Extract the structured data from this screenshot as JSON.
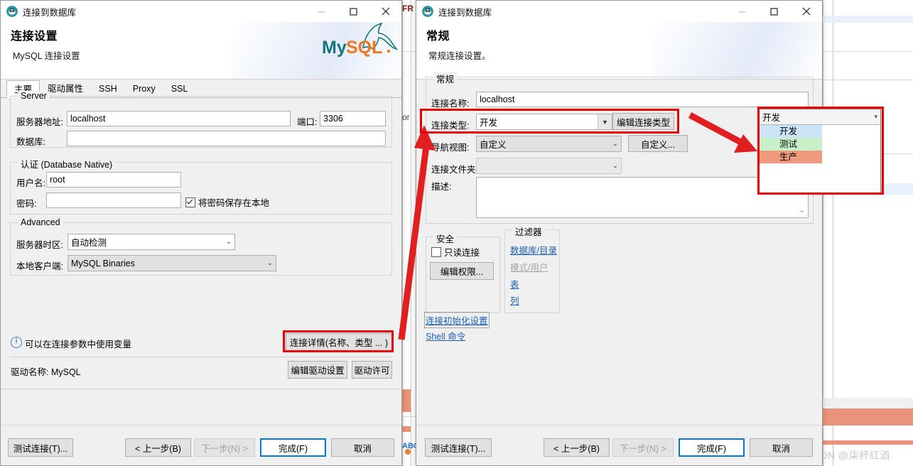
{
  "background": {
    "fragments": [
      {
        "text": "FR",
        "kind": "red"
      },
      {
        "text": "or",
        "kind": "plain"
      },
      {
        "text": "ABC",
        "kind": "blue"
      }
    ],
    "watermark": "CSDN @柒杯红酒"
  },
  "left_dialog": {
    "window_title": "连接到数据库",
    "icon": "app-icon",
    "min_label": "最小化",
    "max_label": "最大化",
    "close_label": "关闭",
    "header_title": "连接设置",
    "header_sub": "MySQL 连接设置",
    "brand": "MySQL",
    "tabs": [
      {
        "label": "主要",
        "active": true
      },
      {
        "label": "驱动属性",
        "active": false
      },
      {
        "label": "SSH",
        "active": false
      },
      {
        "label": "Proxy",
        "active": false
      },
      {
        "label": "SSL",
        "active": false
      }
    ],
    "server_group": {
      "legend": "Server",
      "host_label": "服务器地址:",
      "host_value": "localhost",
      "port_label": "端口:",
      "port_value": "3306",
      "db_label": "数据库:",
      "db_value": ""
    },
    "auth_group": {
      "legend": "认证 (Database Native)",
      "user_label": "用户名:",
      "user_value": "root",
      "pass_label": "密码:",
      "pass_value": "",
      "save_pass_label": "将密码保存在本地",
      "save_pass_checked": true
    },
    "advanced_group": {
      "legend": "Advanced",
      "tz_label": "服务器时区:",
      "tz_value": "自动检测",
      "client_label": "本地客户端:",
      "client_value": "MySQL Binaries"
    },
    "hint": "可以在连接参数中使用变量",
    "details_button": "连接详情(名称、类型 ... )",
    "driver_label": "驱动名称:  MySQL",
    "edit_driver_button": "编辑驱动设置",
    "driver_license_button": "驱动许可",
    "footer": {
      "test": "测试连接(T)...",
      "back": "< 上一步(B)",
      "next": "下一步(N) >",
      "finish": "完成(F)",
      "cancel": "取消"
    }
  },
  "right_dialog": {
    "window_title": "连接到数据库",
    "header_title": "常规",
    "header_sub": "常规连接设置。",
    "general_group": {
      "legend": "常规",
      "conn_name_label": "连接名称:",
      "conn_name_value": "localhost",
      "conn_type_label": "连接类型:",
      "conn_type_value": "开发",
      "edit_conn_type_button": "编辑连接类型",
      "nav_view_label": "导航视图:",
      "nav_view_value": "自定义",
      "nav_view_button": "自定义...",
      "folder_label": "连接文件夹:",
      "folder_value": "",
      "desc_label": "描述:",
      "desc_value": ""
    },
    "security_group": {
      "legend": "安全",
      "readonly_label": "只读连接",
      "readonly_checked": false,
      "edit_perm_button": "编辑权限..."
    },
    "filter_group": {
      "legend": "过滤器",
      "links": [
        {
          "label": "数据库/目录",
          "disabled": false
        },
        {
          "label": "模式/用户",
          "disabled": true
        },
        {
          "label": "表",
          "disabled": false
        },
        {
          "label": "列",
          "disabled": false
        }
      ]
    },
    "bottom_links": [
      {
        "label": "连接初始化设置",
        "focused": true
      },
      {
        "label": "Shell 命令",
        "focused": false
      }
    ],
    "footer": {
      "test": "测试连接(T)...",
      "back": "< 上一步(B)",
      "next": "下一步(N) >",
      "finish": "完成(F)",
      "cancel": "取消"
    }
  },
  "dropdown_popup": {
    "selected": "开发",
    "items": [
      {
        "label": "开发",
        "bg": "#cde4f7",
        "text_color": "#000000",
        "selected": true
      },
      {
        "label": "测试",
        "bg": "#c8f0c8",
        "text_color": "#000000",
        "selected": false
      },
      {
        "label": "生产",
        "bg": "#ee9a7d",
        "text_color": "#000000",
        "selected": false
      }
    ]
  },
  "annotations": {
    "highlight_color": "#e60000",
    "arrow_color": "#e02020"
  }
}
